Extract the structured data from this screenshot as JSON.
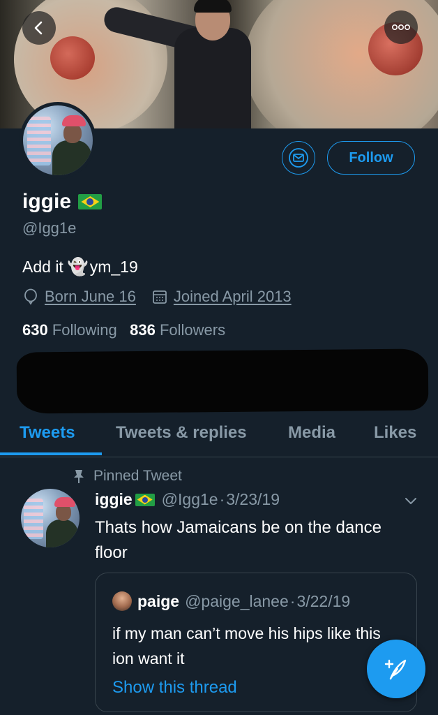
{
  "colors": {
    "background": "#15202b",
    "accent": "#1d9bf0",
    "muted": "#8899a6",
    "border": "#38444d"
  },
  "header": {
    "back_icon": "chevron-left-icon",
    "more_icon": "ellipsis-icon"
  },
  "profile": {
    "name": "iggie",
    "flag": "brazil-flag",
    "handle": "@Igg1e",
    "bio_prefix": "Add it",
    "bio_emoji": "👻",
    "bio_suffix": "ym_19",
    "birthday": "Born June 16",
    "joined": "Joined April 2013",
    "following_count": "630",
    "following_label": "Following",
    "followers_count": "836",
    "followers_label": "Followers"
  },
  "actions": {
    "follow_label": "Follow",
    "message_icon": "envelope-icon"
  },
  "tabs": [
    {
      "label": "Tweets",
      "active": true
    },
    {
      "label": "Tweets & replies",
      "active": false
    },
    {
      "label": "Media",
      "active": false
    },
    {
      "label": "Likes",
      "active": false
    }
  ],
  "pinned_tweet": {
    "pinned_label": "Pinned Tweet",
    "author_name": "iggie",
    "author_handle": "@Igg1e",
    "separator": "·",
    "date": "3/23/19",
    "text": "Thats how Jamaicans be on the dance floor",
    "quoted": {
      "author_name": "paige",
      "author_handle": "@paige_lanee",
      "separator": "·",
      "date": "3/22/19",
      "text": "if my man can’t move his hips like this ion want it",
      "show_thread": "Show this thread"
    }
  },
  "compose": {
    "icon": "compose-feather-icon"
  }
}
